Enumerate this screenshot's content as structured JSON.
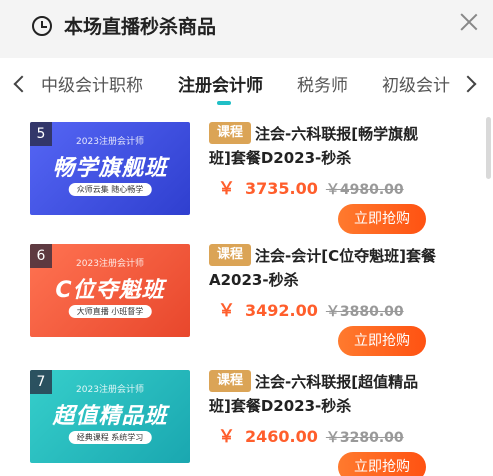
{
  "header": {
    "title": "本场直播秒杀商品"
  },
  "tabs": [
    {
      "label": "中级会计职称"
    },
    {
      "label": "注册会计师"
    },
    {
      "label": "税务师"
    },
    {
      "label": "初级会计"
    }
  ],
  "items": [
    {
      "index": "5",
      "thumb_sub": "2023注册会计师",
      "thumb_title": "畅学旗舰班",
      "thumb_tag": "众师云集 随心畅学",
      "thumb_colors": [
        "#4a5cf0",
        "#2f3fcf"
      ],
      "badge": "课程",
      "title": "注会-六科联报[畅学旗舰班]套餐D2023-秒杀",
      "currency": "￥",
      "price": "3735.00",
      "original_price": "￥4980.00",
      "buy_label": "立即抢购"
    },
    {
      "index": "6",
      "thumb_sub": "2023注册会计师",
      "thumb_title": "C位夺魁班",
      "thumb_tag": "大师直播 小班督学",
      "thumb_colors": [
        "#ff6a45",
        "#e8472c"
      ],
      "badge": "课程",
      "title": "注会-会计[C位夺魁班]套餐A2023-秒杀",
      "currency": "￥",
      "price": "3492.00",
      "original_price": "￥3880.00",
      "buy_label": "立即抢购"
    },
    {
      "index": "7",
      "thumb_sub": "2023注册会计师",
      "thumb_title": "超值精品班",
      "thumb_tag": "经典课程 系统学习",
      "thumb_colors": [
        "#2fc6c6",
        "#1aa7b0"
      ],
      "badge": "课程",
      "title": "注会-六科联报[超值精品班]套餐D2023-秒杀",
      "currency": "￥",
      "price": "2460.00",
      "original_price": "￥3280.00",
      "buy_label": "立即抢购"
    }
  ],
  "colors": {
    "accent": "#ff5e2c",
    "tab_indicator": "#20bfc6",
    "badge": "#dba456"
  }
}
